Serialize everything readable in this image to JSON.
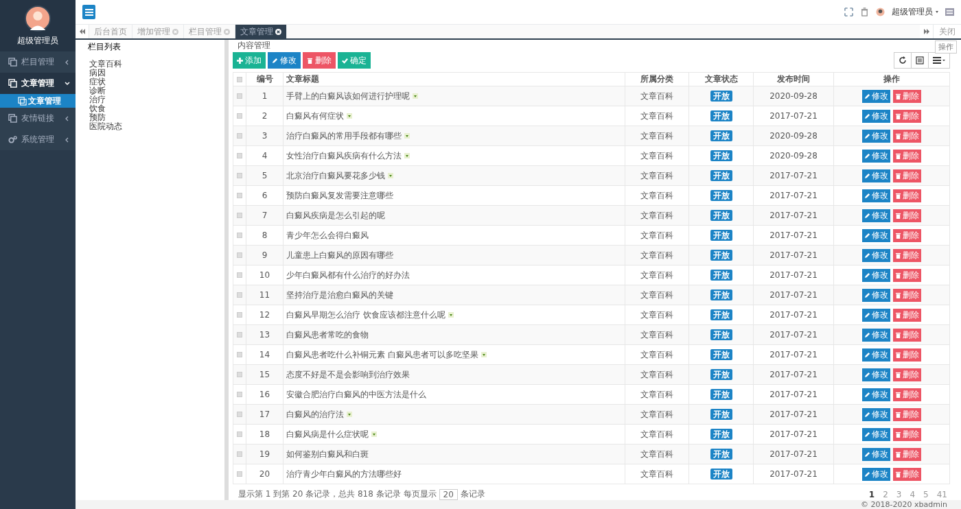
{
  "sidebar": {
    "user": "超级管理员",
    "menu": [
      {
        "label": "栏目管理",
        "expanded": false,
        "selected": false
      },
      {
        "label": "文章管理",
        "expanded": true,
        "selected": true,
        "children": [
          {
            "label": "文章管理",
            "selected": true
          }
        ]
      },
      {
        "label": "友情链接",
        "expanded": false,
        "selected": false
      },
      {
        "label": "系统管理",
        "expanded": false,
        "selected": false
      }
    ]
  },
  "topbar": {
    "user": "超级管理员"
  },
  "tabs": [
    {
      "label": "后台首页",
      "closable": false,
      "selected": false
    },
    {
      "label": "增加管理",
      "closable": true,
      "selected": false
    },
    {
      "label": "栏目管理",
      "closable": true,
      "selected": false
    },
    {
      "label": "文章管理",
      "closable": true,
      "selected": true
    }
  ],
  "tab_close_all": "关闭",
  "float_menu": "操作",
  "category_panel": {
    "title": "栏目列表",
    "items": [
      "文章百科",
      "病因",
      "症状",
      "诊断",
      "治疗",
      "饮食",
      "预防",
      "医院动态"
    ]
  },
  "content": {
    "title": "内容管理",
    "toolbar": [
      {
        "label": "添加",
        "kind": "add"
      },
      {
        "label": "修改",
        "kind": "edit"
      },
      {
        "label": "删除",
        "kind": "delete"
      },
      {
        "label": "确定",
        "kind": "confirm"
      }
    ]
  },
  "table": {
    "all_checked": false,
    "columns": [
      "编号",
      "文章标题",
      "所属分类",
      "文章状态",
      "发布时间",
      "操作"
    ],
    "rows": [
      {
        "checked": false,
        "id": "1",
        "title": "手臂上的白癜风该如何进行护理呢",
        "has_image": true,
        "category": "文章百科",
        "status": "开放",
        "date": "2020-09-28",
        "actions": [
          "修改",
          "删除"
        ]
      },
      {
        "checked": false,
        "id": "2",
        "title": "白癜风有何症状",
        "has_image": true,
        "category": "文章百科",
        "status": "开放",
        "date": "2017-07-21",
        "actions": [
          "修改",
          "删除"
        ]
      },
      {
        "checked": false,
        "id": "3",
        "title": "治疗白癜风的常用手段都有哪些",
        "has_image": true,
        "category": "文章百科",
        "status": "开放",
        "date": "2020-09-28",
        "actions": [
          "修改",
          "删除"
        ]
      },
      {
        "checked": false,
        "id": "4",
        "title": "女性治疗白癜风疾病有什么方法",
        "has_image": true,
        "category": "文章百科",
        "status": "开放",
        "date": "2020-09-28",
        "actions": [
          "修改",
          "删除"
        ]
      },
      {
        "checked": false,
        "id": "5",
        "title": "北京治疗白癜风要花多少钱",
        "has_image": true,
        "category": "文章百科",
        "status": "开放",
        "date": "2017-07-21",
        "actions": [
          "修改",
          "删除"
        ]
      },
      {
        "checked": false,
        "id": "6",
        "title": "预防白癜风复发需要注意哪些",
        "has_image": false,
        "category": "文章百科",
        "status": "开放",
        "date": "2017-07-21",
        "actions": [
          "修改",
          "删除"
        ]
      },
      {
        "checked": false,
        "id": "7",
        "title": "白癜风疾病是怎么引起的呢",
        "has_image": false,
        "category": "文章百科",
        "status": "开放",
        "date": "2017-07-21",
        "actions": [
          "修改",
          "删除"
        ]
      },
      {
        "checked": false,
        "id": "8",
        "title": "青少年怎么会得白癜风",
        "has_image": false,
        "category": "文章百科",
        "status": "开放",
        "date": "2017-07-21",
        "actions": [
          "修改",
          "删除"
        ]
      },
      {
        "checked": false,
        "id": "9",
        "title": "儿童患上白癜风的原因有哪些",
        "has_image": false,
        "category": "文章百科",
        "status": "开放",
        "date": "2017-07-21",
        "actions": [
          "修改",
          "删除"
        ]
      },
      {
        "checked": false,
        "id": "10",
        "title": "少年白癜风都有什么治疗的好办法",
        "has_image": false,
        "category": "文章百科",
        "status": "开放",
        "date": "2017-07-21",
        "actions": [
          "修改",
          "删除"
        ]
      },
      {
        "checked": false,
        "id": "11",
        "title": "坚持治疗是治愈白癜风的关键",
        "has_image": false,
        "category": "文章百科",
        "status": "开放",
        "date": "2017-07-21",
        "actions": [
          "修改",
          "删除"
        ]
      },
      {
        "checked": false,
        "id": "12",
        "title": "白癜风早期怎么治疗 饮食应该都注意什么呢",
        "has_image": true,
        "category": "文章百科",
        "status": "开放",
        "date": "2017-07-21",
        "actions": [
          "修改",
          "删除"
        ]
      },
      {
        "checked": false,
        "id": "13",
        "title": "白癜风患者常吃的食物",
        "has_image": false,
        "category": "文章百科",
        "status": "开放",
        "date": "2017-07-21",
        "actions": [
          "修改",
          "删除"
        ]
      },
      {
        "checked": false,
        "id": "14",
        "title": "白癜风患者吃什么补铜元素 白癜风患者可以多吃坚果",
        "has_image": true,
        "category": "文章百科",
        "status": "开放",
        "date": "2017-07-21",
        "actions": [
          "修改",
          "删除"
        ]
      },
      {
        "checked": false,
        "id": "15",
        "title": "态度不好是不是会影响到治疗效果",
        "has_image": false,
        "category": "文章百科",
        "status": "开放",
        "date": "2017-07-21",
        "actions": [
          "修改",
          "删除"
        ]
      },
      {
        "checked": false,
        "id": "16",
        "title": "安徽合肥治疗白癜风的中医方法是什么",
        "has_image": false,
        "category": "文章百科",
        "status": "开放",
        "date": "2017-07-21",
        "actions": [
          "修改",
          "删除"
        ]
      },
      {
        "checked": false,
        "id": "17",
        "title": "白癜风的治疗法",
        "has_image": true,
        "category": "文章百科",
        "status": "开放",
        "date": "2017-07-21",
        "actions": [
          "修改",
          "删除"
        ]
      },
      {
        "checked": false,
        "id": "18",
        "title": "白癜风病是什么症状呢",
        "has_image": true,
        "category": "文章百科",
        "status": "开放",
        "date": "2017-07-21",
        "actions": [
          "修改",
          "删除"
        ]
      },
      {
        "checked": false,
        "id": "19",
        "title": "如何鉴别白癜风和白斑",
        "has_image": false,
        "category": "文章百科",
        "status": "开放",
        "date": "2017-07-21",
        "actions": [
          "修改",
          "删除"
        ]
      },
      {
        "checked": false,
        "id": "20",
        "title": "治疗青少年白癜风的方法哪些好",
        "has_image": false,
        "category": "文章百科",
        "status": "开放",
        "date": "2017-07-21",
        "actions": [
          "修改",
          "删除"
        ]
      }
    ]
  },
  "pagination": {
    "info": "显示第 1 到第 20 条记录，总共 818 条记录 每页显示",
    "page_size": "20",
    "suffix": "条记录",
    "pages": [
      {
        "label": "1",
        "selected": true
      },
      {
        "label": "2",
        "selected": false
      },
      {
        "label": "3",
        "selected": false
      },
      {
        "label": "4",
        "selected": false
      },
      {
        "label": "5",
        "selected": false
      },
      {
        "label": "41",
        "selected": false
      }
    ]
  },
  "footer": "© 2018-2020 xbadmin"
}
